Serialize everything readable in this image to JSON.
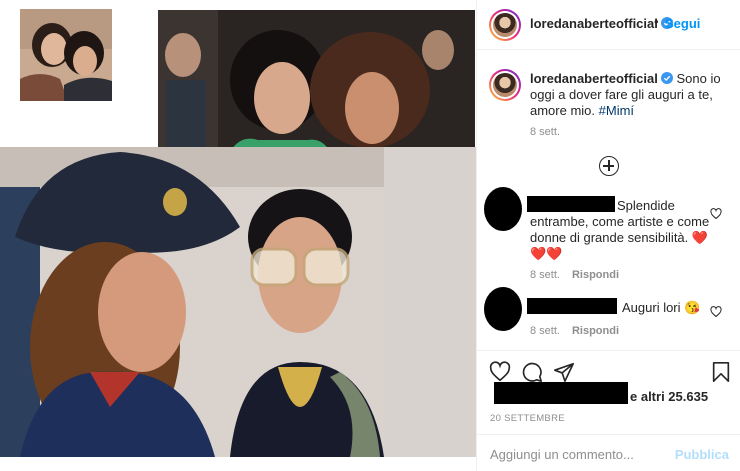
{
  "post": {
    "username": "loredanaberteofficial",
    "follow_separator": "•",
    "follow_label": "Segui",
    "more_icon": "more-icon",
    "caption": {
      "text": "Sono io oggi a dover fare gli auguri a te, amore mio.",
      "hashtag": "#Mimí",
      "time": "8 sett."
    },
    "load_more_icon": "plus-circle-icon",
    "comments": [
      {
        "text": "Splendide entrambe, come artiste e come donne di grande sensibilità.",
        "emoji": "❤️ ❤️❤️",
        "time": "8 sett.",
        "reply_label": "Rispondi"
      },
      {
        "text": "Auguri lori 😘",
        "time": "8 sett.",
        "reply_label": "Rispondi"
      }
    ],
    "likes_text": "e altri 25.635",
    "date": "20 SETTEMBRE",
    "add_comment_placeholder": "Aggiungi un commento...",
    "publish_label": "Pubblica"
  },
  "colors": {
    "accent": "#0095f6",
    "hashtag": "#00376b",
    "muted": "#8e8e8e",
    "publish_disabled": "#b2dffc",
    "heart_red": "#ed4956"
  }
}
